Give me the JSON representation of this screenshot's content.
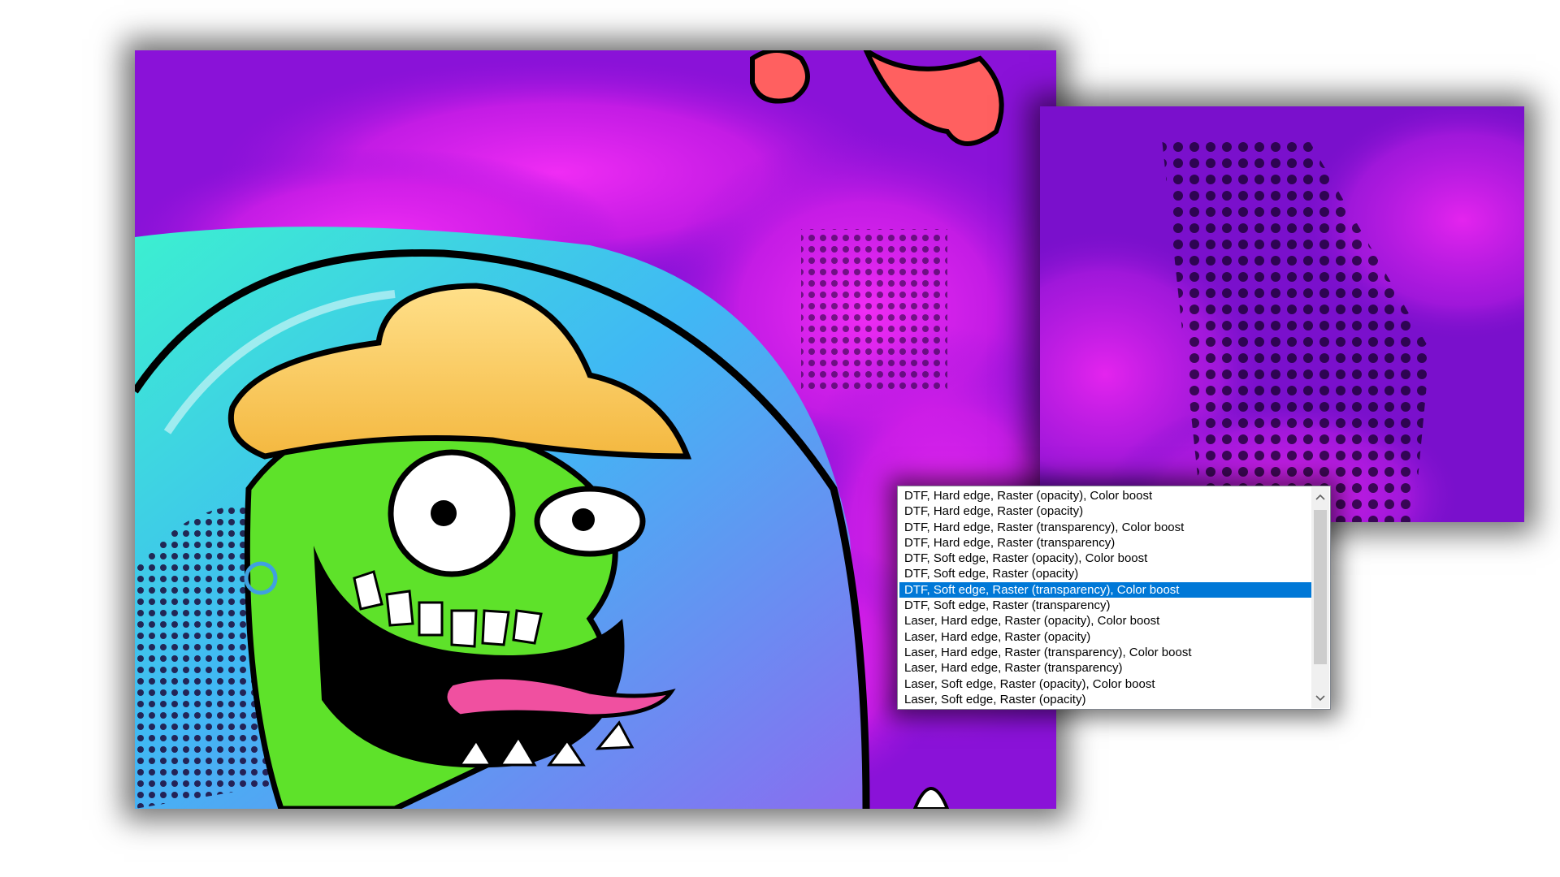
{
  "artwork": {
    "description_icon": "cartoon-monster-artwork",
    "colors": {
      "sky_purple": "#8a12d8",
      "cloud_magenta": "#e020f0",
      "bubble_cyan": "#38c8f0",
      "monster_green": "#5ee22a",
      "hat_yellow": "#ffd56a",
      "tongue_pink": "#f050a0"
    }
  },
  "zoom_preview": {
    "icon": "zoomed-halftone-preview"
  },
  "preset_list": {
    "selected_index": 6,
    "items": [
      "DTF, Hard edge, Raster (opacity), Color boost",
      "DTF, Hard edge, Raster (opacity)",
      "DTF, Hard edge, Raster (transparency), Color boost",
      "DTF, Hard edge, Raster (transparency)",
      "DTF, Soft edge, Raster (opacity), Color boost",
      "DTF, Soft edge, Raster (opacity)",
      "DTF, Soft edge, Raster (transparency), Color boost",
      "DTF, Soft edge, Raster (transparency)",
      "Laser, Hard edge, Raster (opacity), Color boost",
      "Laser, Hard edge, Raster (opacity)",
      "Laser, Hard edge, Raster (transparency), Color boost",
      "Laser, Hard edge, Raster (transparency)",
      "Laser, Soft edge, Raster (opacity), Color boost",
      "Laser, Soft edge, Raster (opacity)"
    ],
    "colors": {
      "selection": "#0078d7",
      "selection_text": "#ffffff"
    },
    "scrollbar": {
      "up_icon": "chevron-up-icon",
      "down_icon": "chevron-down-icon"
    }
  }
}
